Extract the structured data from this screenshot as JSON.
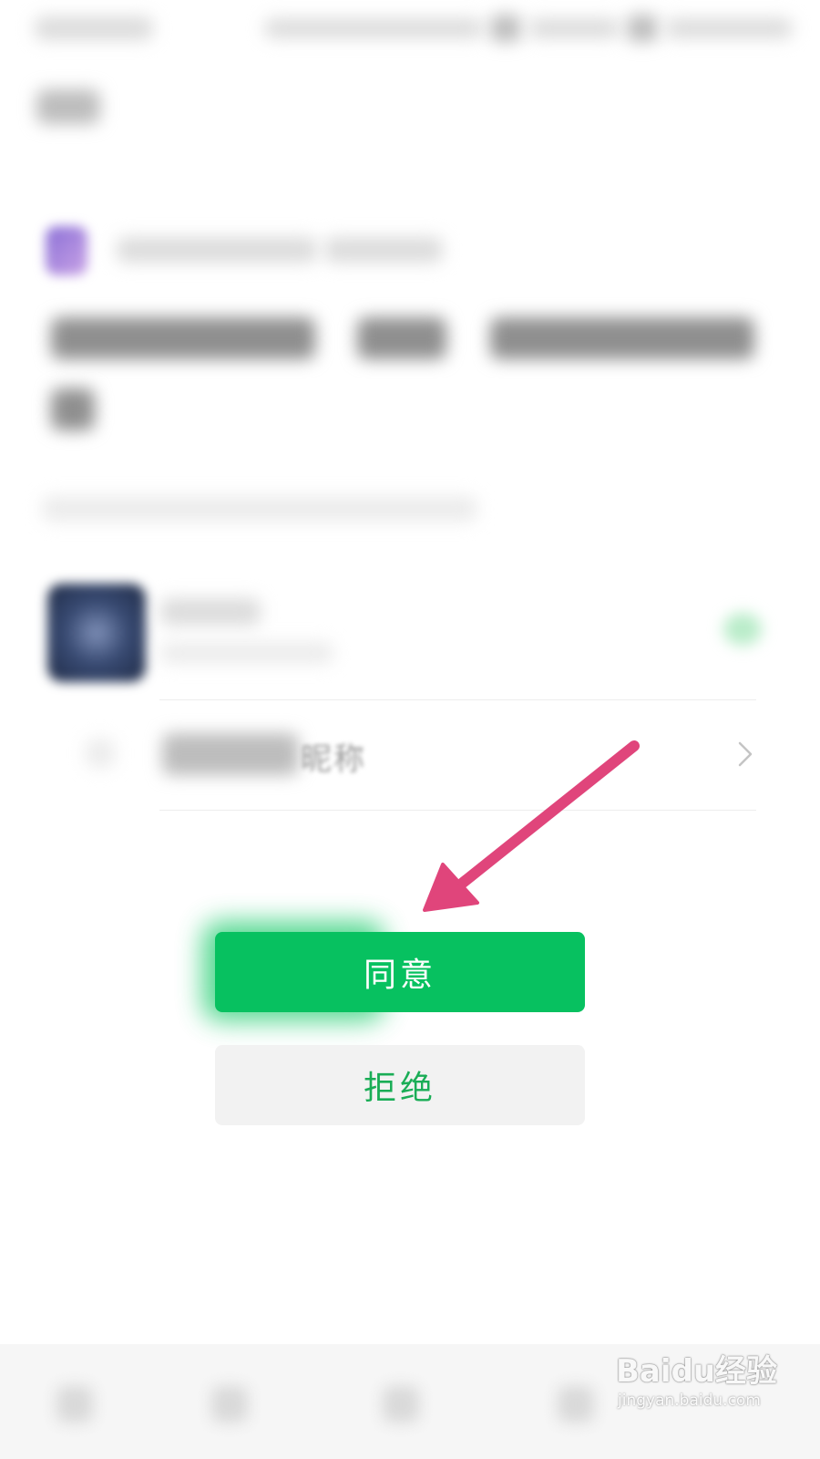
{
  "nickname_row": {
    "label": "昵称"
  },
  "actions": {
    "agree_label": "同意",
    "reject_label": "拒绝"
  },
  "watermark": {
    "brand": "Baidu经验",
    "url": "jingyan.baidu.com"
  },
  "colors": {
    "agree_bg": "#07c160",
    "reject_bg": "#f2f2f2",
    "reject_text": "#1aad56",
    "arrow": "#e0457b"
  },
  "icons": {
    "chevron": "chevron-right-icon",
    "arrow": "pointer-arrow-icon"
  }
}
